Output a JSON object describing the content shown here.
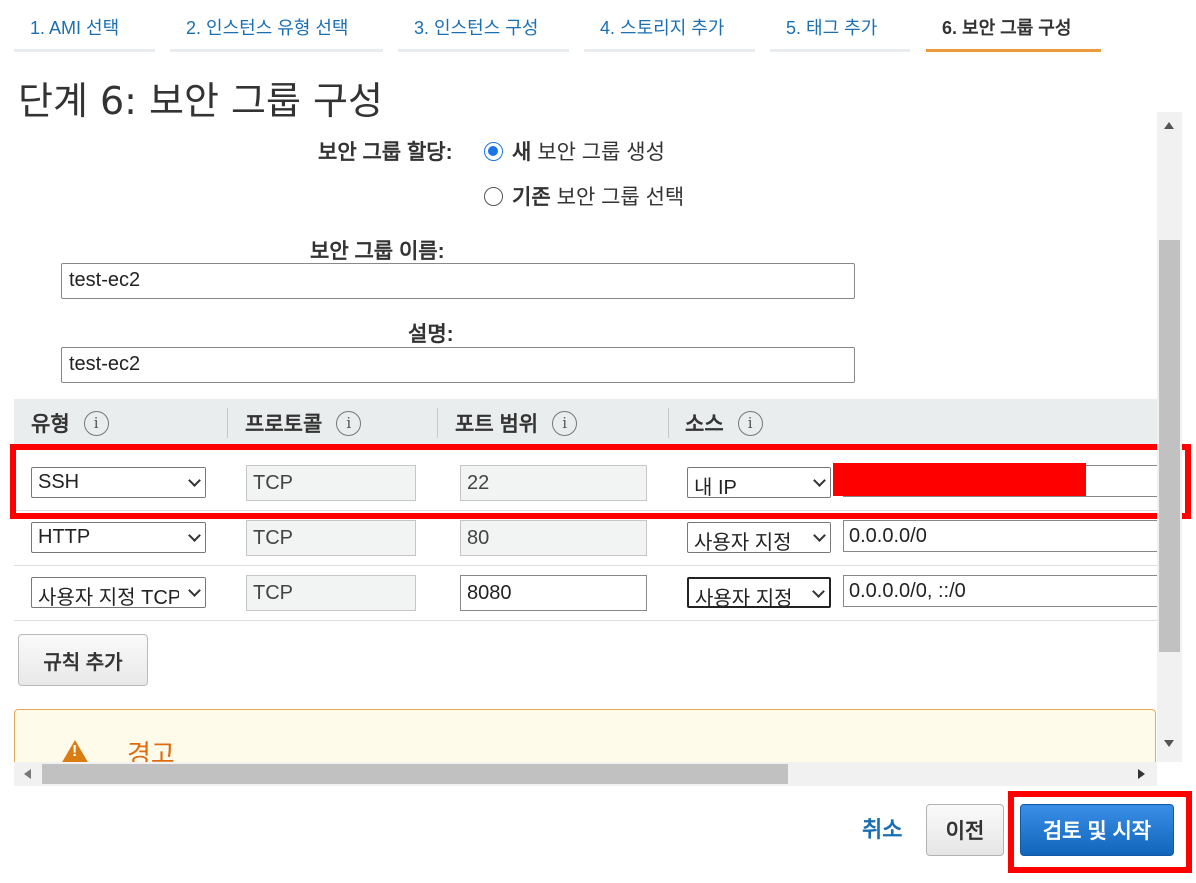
{
  "wizard": {
    "steps": [
      {
        "label": "1. AMI 선택"
      },
      {
        "label": "2. 인스턴스 유형 선택"
      },
      {
        "label": "3. 인스턴스 구성"
      },
      {
        "label": "4. 스토리지 추가"
      },
      {
        "label": "5. 태그 추가"
      },
      {
        "label": "6. 보안 그룹 구성"
      }
    ],
    "active_step": 6
  },
  "page": {
    "title": "단계 6: 보안 그룹 구성"
  },
  "assignment": {
    "label": "보안 그룹 할당:",
    "options": [
      {
        "bold": "새",
        "rest": "보안 그룹 생성",
        "checked": true
      },
      {
        "bold": "기존",
        "rest": "보안 그룹 선택",
        "checked": false
      }
    ]
  },
  "group_name": {
    "label": "보안 그룹 이름:",
    "value": "test-ec2"
  },
  "description": {
    "label": "설명:",
    "value": "test-ec2"
  },
  "rules_table": {
    "headers": [
      "유형",
      "프로토콜",
      "포트 범위",
      "소스"
    ],
    "info_glyph": "i",
    "rows": [
      {
        "type": "SSH",
        "protocol": "TCP",
        "port": "22",
        "source_type": "내 IP",
        "source_value": ""
      },
      {
        "type": "HTTP",
        "protocol": "TCP",
        "port": "80",
        "source_type": "사용자 지정",
        "source_value": "0.0.0.0/0"
      },
      {
        "type": "사용자 지정 TCP",
        "protocol": "TCP",
        "port": "8080",
        "source_type": "사용자 지정",
        "source_value": "0.0.0.0/0, ::/0"
      }
    ]
  },
  "add_rule_label": "규칙 추가",
  "warning": {
    "title": "경고"
  },
  "footer": {
    "cancel_label": "취소",
    "previous_label": "이전",
    "launch_label": "검토 및 시작"
  },
  "colors": {
    "link": "#1a6fb3",
    "active_tab_underline": "#ec9b3a",
    "primary_button": "#1166bb",
    "highlight": "#ff0000",
    "warning": "#dd6b10"
  }
}
